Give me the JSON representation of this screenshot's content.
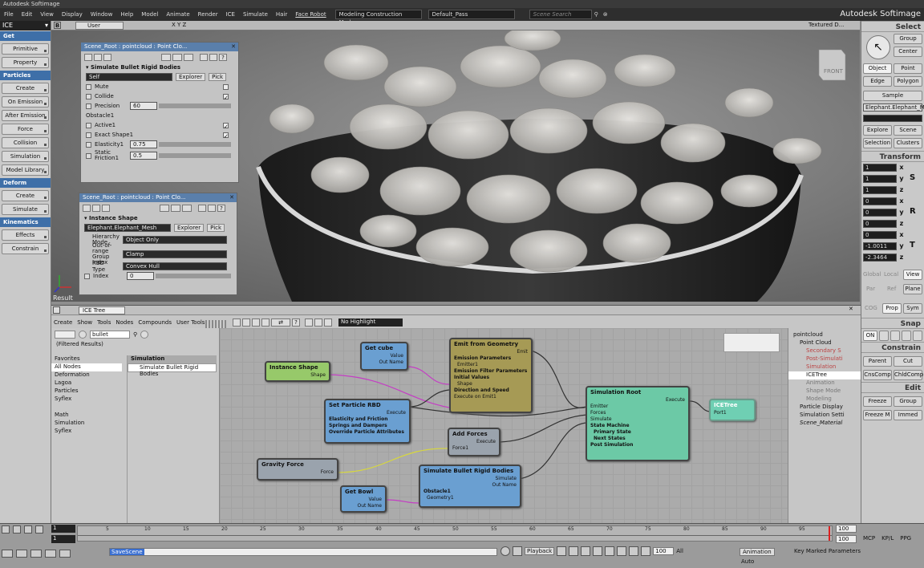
{
  "app": {
    "title": "Autodesk Softimage",
    "brand": "Autodesk Softimage"
  },
  "menu": [
    "File",
    "Edit",
    "View",
    "Display",
    "Window",
    "Help",
    "Model",
    "Animate",
    "Render",
    "ICE",
    "Simulate",
    "Hair",
    "Face Robot"
  ],
  "top_selects": {
    "mode": "Modeling Construction Mode",
    "pass": "Default_Pass",
    "search_placeholder": "Scene Search"
  },
  "left_toolbar": {
    "mode_select": "ICE",
    "sections": [
      {
        "header": "Get",
        "buttons": [
          "Primitive",
          "Property"
        ]
      },
      {
        "header": "Particles",
        "buttons": [
          "Create",
          "On Emission",
          "After Emission",
          "Force",
          "Collision",
          "Simulation",
          "Model Library"
        ]
      },
      {
        "header": "Deform",
        "buttons": [
          "Create",
          "Simulate"
        ]
      },
      {
        "header": "Kinematics",
        "buttons": [
          "Effects",
          "Constrain"
        ]
      }
    ]
  },
  "viewport": {
    "label": "B",
    "camera": "User",
    "axes": "X Y Z",
    "display": "Textured D...",
    "cube_label": "FRONT",
    "result": "Result"
  },
  "panel1": {
    "title": "Scene_Root : pointcloud : Point Clo...",
    "section": "Simulate Bullet Rigid Bodies",
    "field": "Self",
    "explorer": "Explorer",
    "pick": "Pick",
    "rows": {
      "mute": "Mute",
      "collide": "Collide",
      "precision": "Precision",
      "precision_val": "60",
      "obstacle": "Obstacle1",
      "active": "Active1",
      "exact": "Exact Shape1",
      "elasticity": "Elasticity1",
      "elasticity_val": "0.75",
      "static": "Static Friction1",
      "static_val": "0.5"
    }
  },
  "panel2": {
    "title": "Scene_Root : pointcloud : Point Clo...",
    "section": "Instance Shape",
    "field": "Elephant.Elephant_Mesh",
    "explorer": "Explorer",
    "pick": "Pick",
    "rows": {
      "hier_label": "Hierarchy Mode",
      "hier_val": "Object Only",
      "oor_label": "Out-of-range Group Index",
      "oor_val": "Clamp",
      "rbd_label": "RBD Type",
      "rbd_val": "Convex Hull",
      "index_label": "Index",
      "index_val": "0"
    }
  },
  "right_toolbar": {
    "select_header": "Select",
    "buttons1": [
      "Group",
      "Center"
    ],
    "buttons2": [
      "Object",
      "Point",
      "Edge",
      "Polygon"
    ],
    "sample": "Sample",
    "selected_name": "Elephant.Elephant_M",
    "buttons3": [
      "Explore",
      "Scene",
      "Selection",
      "Clusters"
    ],
    "transform_header": "Transform",
    "scale": [
      "1",
      "1",
      "1"
    ],
    "rotate": [
      "0",
      "0",
      "0"
    ],
    "translate": [
      "0",
      "-1.0011",
      "-2.3464"
    ],
    "axis_letters": [
      "x",
      "y",
      "z"
    ],
    "srt": [
      "S",
      "R",
      "T"
    ],
    "ref_buttons": [
      "Global",
      "Local",
      "View",
      "Par",
      "Ref",
      "Plane",
      "COG",
      "Prop",
      "Sym"
    ],
    "snap_header": "Snap",
    "snap_on": "ON",
    "constrain_header": "Constrain",
    "buttons4": [
      "Parent",
      "Cut",
      "CnsComp",
      "ChldComp"
    ],
    "edit_header": "Edit",
    "buttons5": [
      "Freeze",
      "Group",
      "Freeze M",
      "Immed"
    ]
  },
  "ice": {
    "title": "ICE Tree",
    "menu": [
      "Create",
      "Show",
      "Tools",
      "Nodes",
      "Compounds",
      "User Tools"
    ],
    "highlight": "No Highlight",
    "search": "bullet",
    "filtered": "(Filtered Results)",
    "categories": [
      "Favorites",
      "All Nodes",
      "Deformation",
      "Lagoa",
      "Particles",
      "Syflex",
      "",
      "Math",
      "Simulation",
      "Syflex"
    ],
    "results_header": "Simulation",
    "results": [
      "Simulate Bullet Rigid Bodies"
    ],
    "explorer": [
      "pointcloud",
      "Point Cloud",
      "Secondary S",
      "Post-Simulati",
      "Simulation",
      "ICETree",
      "Animation",
      "Shape Mode",
      "Modeling",
      "Particle Display",
      "Simulation Setti",
      "Scene_Material"
    ],
    "nodes": {
      "get_cube": {
        "title": "Get cube",
        "ports": [
          "Value",
          "Out Name"
        ]
      },
      "instance_shape": {
        "title": "Instance Shape",
        "ports": [
          "Shape"
        ]
      },
      "emit": {
        "title": "Emit from Geometry",
        "out": "Emit",
        "rows": [
          "Emission Parameters",
          "Emitter1",
          "Emission Filter Parameters",
          "Initial Values",
          "Shape",
          "Direction and Speed",
          "Execute on Emit1"
        ]
      },
      "set_rbd": {
        "title": "Set Particle RBD",
        "out": "Execute",
        "rows": [
          "Elasticity and Friction",
          "Springs and Dampers",
          "Override Particle Attributes"
        ]
      },
      "add_forces": {
        "title": "Add Forces",
        "out": "Execute",
        "in": "Force1"
      },
      "gravity": {
        "title": "Gravity Force",
        "out": "Force"
      },
      "sim_bullet": {
        "title": "Simulate Bullet Rigid Bodies",
        "outs": [
          "Simulate",
          "Out Name"
        ],
        "rows": [
          "Obstacle1",
          "Geometry1"
        ]
      },
      "get_bowl": {
        "title": "Get Bowl",
        "ports": [
          "Value",
          "Out Name"
        ]
      },
      "sim_root": {
        "title": "Simulation Root",
        "out": "Execute",
        "rows": [
          "Emitter",
          "Forces",
          "Simulate",
          "State Machine",
          "Primary State",
          "Next States",
          "Post Simulation"
        ]
      },
      "icetree": {
        "title": "ICETree",
        "in": "Port1"
      }
    }
  },
  "timeline": {
    "start": "1",
    "end": "100",
    "end2": "100",
    "current": "1",
    "ticks": [
      "5",
      "10",
      "15",
      "20",
      "25",
      "30",
      "35",
      "40",
      "45",
      "50",
      "55",
      "60",
      "65",
      "70",
      "75",
      "80",
      "85",
      "90",
      "95"
    ],
    "script": "SaveScene",
    "playback": "Playback",
    "frame": "100",
    "all": "All",
    "animation": "Animation",
    "auto": "Auto",
    "key_marked": "Key Marked Parameters",
    "tabs": [
      "MCP",
      "KP/L",
      "PPG"
    ]
  }
}
